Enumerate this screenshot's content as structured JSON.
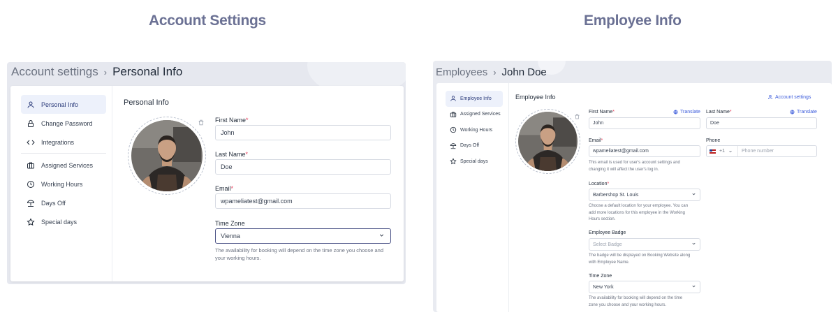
{
  "titles": {
    "left": "Account Settings",
    "right": "Employee Info"
  },
  "account": {
    "breadcrumb": {
      "parent": "Account settings",
      "separator": "›",
      "current": "Personal Info"
    },
    "nav": [
      {
        "label": "Personal Info",
        "icon": "user-icon",
        "active": true
      },
      {
        "label": "Change Password",
        "icon": "lock-icon"
      },
      {
        "label": "Integrations",
        "icon": "code-icon"
      },
      {
        "label": "Assigned Services",
        "icon": "briefcase-icon"
      },
      {
        "label": "Working Hours",
        "icon": "clock-icon"
      },
      {
        "label": "Days Off",
        "icon": "beach-umbrella-icon"
      },
      {
        "label": "Special days",
        "icon": "star-icon"
      }
    ],
    "heading": "Personal Info",
    "first_name": {
      "label": "First Name",
      "required": "*",
      "value": "John"
    },
    "last_name": {
      "label": "Last Name",
      "required": "*",
      "value": "Doe"
    },
    "email": {
      "label": "Email",
      "required": "*",
      "value": "wpameliatest@gmail.com"
    },
    "timezone": {
      "label": "Time Zone",
      "value": "Vienna",
      "hint_line1": "The availability for booking will depend on the time zone you choose and",
      "hint_line2": "your working hours."
    }
  },
  "employee": {
    "breadcrumb": {
      "parent": "Employees",
      "separator": "›",
      "current": "John Doe"
    },
    "nav": [
      {
        "label": "Employee Info",
        "icon": "user-icon",
        "active": true
      },
      {
        "label": "Assigned Services",
        "icon": "briefcase-icon"
      },
      {
        "label": "Working Hours",
        "icon": "clock-icon"
      },
      {
        "label": "Days Off",
        "icon": "beach-umbrella-icon"
      },
      {
        "label": "Special days",
        "icon": "star-icon"
      }
    ],
    "heading": "Employee Info",
    "account_settings_link": "Account settings",
    "first_name": {
      "label": "First Name",
      "required": "*",
      "value": "John",
      "translate": "Translate"
    },
    "last_name": {
      "label": "Last Name",
      "required": "*",
      "value": "Doe",
      "translate": "Translate"
    },
    "email": {
      "label": "Email",
      "required": "*",
      "value": "wpameliatest@gmail.com",
      "hint_line1": "This email is used for user's account settings and",
      "hint_line2": "changing it will affect the user's log in."
    },
    "phone": {
      "label": "Phone",
      "country_code": "+1",
      "placeholder": "Phone number"
    },
    "location": {
      "label": "Location",
      "required": "*",
      "value": "Barbershop St. Louis",
      "hint_line1": "Choose a default location for your employee. You can",
      "hint_line2": "add more locations for this employee in the Working",
      "hint_line3": "Hours section."
    },
    "badge": {
      "label": "Employee Badge",
      "placeholder": "Select Badge",
      "hint_line1": "The badge will be displayed on Booking Website along",
      "hint_line2": "with Employee Name."
    },
    "timezone": {
      "label": "Time Zone",
      "value": "New York",
      "hint_line1": "The availability for booking will depend on the time",
      "hint_line2": "zone you choose and your working hours."
    }
  },
  "colors": {
    "title": "#6b7194",
    "active_nav_bg": "#edf1fb",
    "link": "#3b5bdb",
    "required": "#e53e5c"
  }
}
